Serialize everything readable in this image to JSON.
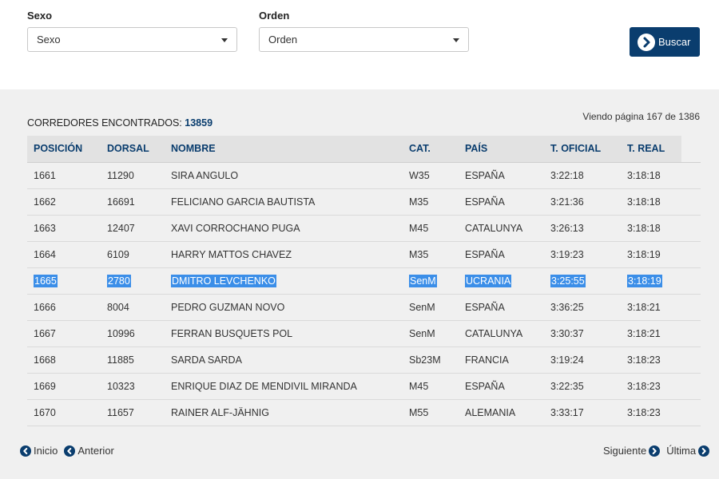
{
  "filters": {
    "sexo": {
      "label": "Sexo",
      "value": "Sexo"
    },
    "orden": {
      "label": "Orden",
      "value": "Orden"
    },
    "search_button": "Buscar"
  },
  "results": {
    "found_label": "CORREDORES ENCONTRADOS:",
    "found_count": "13859",
    "page_info": "Viendo página 167 de 1386"
  },
  "table": {
    "columns": [
      "POSICIÓN",
      "DORSAL",
      "NOMBRE",
      "CAT.",
      "PAÍS",
      "T. OFICIAL",
      "T. REAL"
    ],
    "rows": [
      {
        "pos": "1661",
        "dorsal": "11290",
        "nombre": "SIRA ANGULO",
        "cat": "W35",
        "pais": "ESPAÑA",
        "oficial": "3:22:18",
        "real": "3:18:18",
        "highlighted": false
      },
      {
        "pos": "1662",
        "dorsal": "16691",
        "nombre": "FELICIANO GARCIA BAUTISTA",
        "cat": "M35",
        "pais": "ESPAÑA",
        "oficial": "3:21:36",
        "real": "3:18:18",
        "highlighted": false
      },
      {
        "pos": "1663",
        "dorsal": "12407",
        "nombre": "XAVI CORROCHANO PUGA",
        "cat": "M45",
        "pais": "CATALUNYA",
        "oficial": "3:26:13",
        "real": "3:18:18",
        "highlighted": false
      },
      {
        "pos": "1664",
        "dorsal": "6109",
        "nombre": "HARRY MATTOS CHAVEZ",
        "cat": "M35",
        "pais": "ESPAÑA",
        "oficial": "3:19:23",
        "real": "3:18:19",
        "highlighted": false
      },
      {
        "pos": "1665",
        "dorsal": "2780",
        "nombre": "DMITRO LEVCHENKO",
        "cat": "SenM",
        "pais": "UCRANIA",
        "oficial": "3:25:55",
        "real": "3:18:19",
        "highlighted": true
      },
      {
        "pos": "1666",
        "dorsal": "8004",
        "nombre": "PEDRO GUZMAN NOVO",
        "cat": "SenM",
        "pais": "ESPAÑA",
        "oficial": "3:36:25",
        "real": "3:18:21",
        "highlighted": false
      },
      {
        "pos": "1667",
        "dorsal": "10996",
        "nombre": "FERRAN BUSQUETS POL",
        "cat": "SenM",
        "pais": "CATALUNYA",
        "oficial": "3:30:37",
        "real": "3:18:21",
        "highlighted": false
      },
      {
        "pos": "1668",
        "dorsal": "11885",
        "nombre": "SARDA SARDA",
        "cat": "Sb23M",
        "pais": "FRANCIA",
        "oficial": "3:19:24",
        "real": "3:18:23",
        "highlighted": false
      },
      {
        "pos": "1669",
        "dorsal": "10323",
        "nombre": "ENRIQUE DIAZ DE MENDIVIL MIRANDA",
        "cat": "M45",
        "pais": "ESPAÑA",
        "oficial": "3:22:35",
        "real": "3:18:23",
        "highlighted": false
      },
      {
        "pos": "1670",
        "dorsal": "11657",
        "nombre": "RAINER ALF-JÄHNIG",
        "cat": "M55",
        "pais": "ALEMANIA",
        "oficial": "3:33:17",
        "real": "3:18:23",
        "highlighted": false
      }
    ]
  },
  "pagination": {
    "first": "Inicio",
    "prev": "Anterior",
    "next": "Siguiente",
    "last": "Última"
  },
  "icons": {
    "search_button_icon": "arrow-circle-right-icon",
    "prev_icon": "chevron-circle-left-icon",
    "next_icon": "chevron-circle-right-icon"
  },
  "colors": {
    "accent": "#0a3d6e",
    "highlight": "#3b8ee8"
  }
}
